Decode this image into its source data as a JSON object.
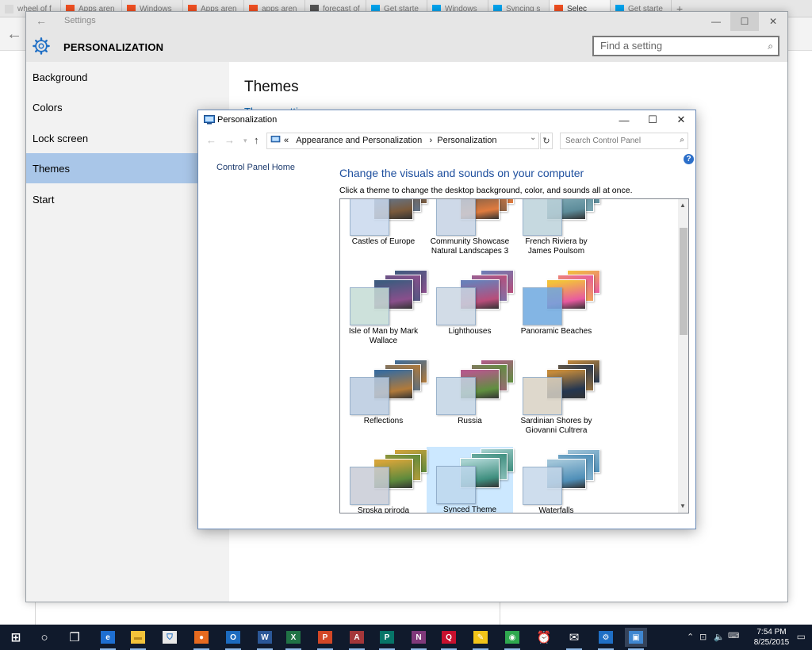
{
  "browser": {
    "tabs": [
      {
        "label": "wheel of f",
        "color": "#d8d8d8"
      },
      {
        "label": "Apps aren",
        "color": "#f25022"
      },
      {
        "label": "Windows",
        "color": "#f25022"
      },
      {
        "label": "Apps aren",
        "color": "#f25022"
      },
      {
        "label": "apps aren",
        "color": "#f25022"
      },
      {
        "label": "forecast of",
        "color": "#555555"
      },
      {
        "label": "Get starte",
        "color": "#00a4ef"
      },
      {
        "label": "Windows",
        "color": "#00a4ef"
      },
      {
        "label": "Syncing s",
        "color": "#00a4ef"
      },
      {
        "label": "Selec",
        "color": "#f25022"
      },
      {
        "label": "Get starte",
        "color": "#00a4ef"
      }
    ],
    "new_tab": "+"
  },
  "settings": {
    "title": "Settings",
    "section": "PERSONALIZATION",
    "search_placeholder": "Find a setting",
    "nav": [
      {
        "label": "Background"
      },
      {
        "label": "Colors"
      },
      {
        "label": "Lock screen"
      },
      {
        "label": "Themes",
        "selected": true
      },
      {
        "label": "Start"
      }
    ],
    "main_title": "Themes",
    "main_link": "Theme settings"
  },
  "control_panel": {
    "title": "Personalization",
    "breadcrumb": [
      "Appearance and Personalization",
      "Personalization"
    ],
    "breadcrumb_prefix": "«",
    "breadcrumb_sep": "›",
    "search_placeholder": "Search Control Panel",
    "sidebar_link": "Control Panel Home",
    "heading": "Change the visuals and sounds on your computer",
    "subheading": "Click a theme to change the desktop background, color, and sounds all at once.",
    "help": "?",
    "themes": [
      {
        "label": "Castles of Europe",
        "colors": [
          "#c9d9ee",
          "#7a5a3c",
          "#5b7fa8"
        ]
      },
      {
        "label": "Community Showcase Natural Landscapes 3",
        "colors": [
          "#c6d3e4",
          "#e07b3e",
          "#6b5a4a"
        ]
      },
      {
        "label": "French Riviera by James Poulsom",
        "colors": [
          "#bdd3db",
          "#5d8c9a",
          "#8ab3bd"
        ]
      },
      {
        "label": "Isle of Man by Mark Wallace",
        "colors": [
          "#c5dcd5",
          "#8a4f8c",
          "#3f5b7f"
        ]
      },
      {
        "label": "Lighthouses",
        "colors": [
          "#cbd7e3",
          "#b84d7a",
          "#6a7fb8"
        ]
      },
      {
        "label": "Panoramic Beaches",
        "colors": [
          "#6ea9e0",
          "#e85aa0",
          "#f3c23a"
        ]
      },
      {
        "label": "Reflections",
        "colors": [
          "#b9cbe0",
          "#b17a3a",
          "#3d6c9a"
        ]
      },
      {
        "label": "Russia",
        "colors": [
          "#c3d4e4",
          "#5f8f3f",
          "#b35a8a"
        ]
      },
      {
        "label": "Sardinian Shores by Giovanni Cultrera",
        "colors": [
          "#d9d2c4",
          "#243650",
          "#c48a3a"
        ]
      },
      {
        "label": "Srpska priroda",
        "colors": [
          "#c8ccd6",
          "#5e8a3c",
          "#d4a43a"
        ]
      },
      {
        "label": "Synced Theme",
        "colors": [
          "#bfd8ee",
          "#3f8f7f",
          "#a8d2d0"
        ],
        "selected": true
      },
      {
        "label": "Waterfalls",
        "colors": [
          "#c6d8ea",
          "#4f8fb8",
          "#a0c4d8"
        ]
      }
    ]
  },
  "taskbar": {
    "apps": [
      {
        "name": "start",
        "glyph": "⊞",
        "color": "#101a2c"
      },
      {
        "name": "search",
        "glyph": "○",
        "color": "#101a2c"
      },
      {
        "name": "task-view",
        "glyph": "❐",
        "color": "#101a2c"
      },
      {
        "name": "edge",
        "glyph": "e",
        "color": "#1e6fd1"
      },
      {
        "name": "file-explorer",
        "glyph": "▬",
        "color": "#f3c33a"
      },
      {
        "name": "store",
        "glyph": "⛉",
        "color": "#e8e8e8"
      },
      {
        "name": "firefox",
        "glyph": "●",
        "color": "#e66a1f"
      },
      {
        "name": "outlook",
        "glyph": "O",
        "color": "#1c6bbf"
      },
      {
        "name": "word",
        "glyph": "W",
        "color": "#2b5797"
      },
      {
        "name": "excel",
        "glyph": "X",
        "color": "#217346"
      },
      {
        "name": "powerpoint",
        "glyph": "P",
        "color": "#d24726"
      },
      {
        "name": "access",
        "glyph": "A",
        "color": "#a4373a"
      },
      {
        "name": "publisher",
        "glyph": "P",
        "color": "#077568"
      },
      {
        "name": "onenote",
        "glyph": "N",
        "color": "#80397b"
      },
      {
        "name": "quicken",
        "glyph": "Q",
        "color": "#c8102e"
      },
      {
        "name": "paint",
        "glyph": "✎",
        "color": "#f2c419"
      },
      {
        "name": "chrome",
        "glyph": "◉",
        "color": "#2fa84f"
      },
      {
        "name": "alarm",
        "glyph": "⏰",
        "color": "#101a2c"
      },
      {
        "name": "mail",
        "glyph": "✉",
        "color": "#101a2c"
      },
      {
        "name": "settings",
        "glyph": "⚙",
        "color": "#1f6fc5"
      },
      {
        "name": "control-panel",
        "glyph": "▣",
        "color": "#3f86d0"
      }
    ],
    "time": "7:54 PM",
    "date": "8/25/2015"
  }
}
